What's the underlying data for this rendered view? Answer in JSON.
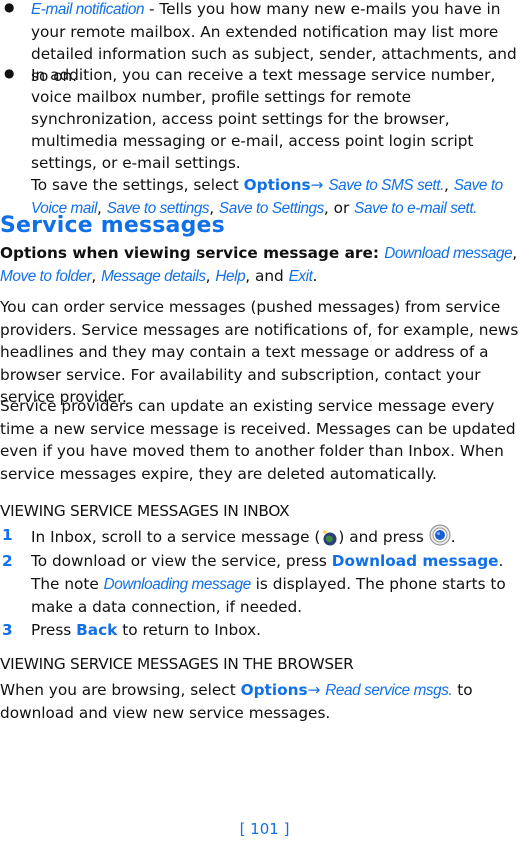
{
  "bullets": [
    {
      "term": "E-mail notification",
      "text": " - Tells you how many new e-mails you have in your remote mailbox. An extended notification may list more detailed information such as subject, sender, attachments, and so on."
    },
    {
      "text": "In addition, you can receive a text message service number, voice mailbox number, profile settings for remote synchronization, access point settings for the browser, multimedia messaging or e-mail, access point login script settings, or e-mail settings.",
      "save_prefix": "To save the settings, select ",
      "options_label": "Options",
      "arrow": "→ ",
      "save_options": [
        "Save to SMS sett.",
        "Save to Voice mail",
        "Save to settings",
        "Save to Settings",
        "Save to e-mail sett."
      ],
      "sep": ", ",
      "or": ", or "
    }
  ],
  "section": {
    "title": "Service messages",
    "options_intro": "Options when viewing service message are: ",
    "options": [
      "Download message",
      "Move to folder",
      "Message details",
      "Help",
      "Exit"
    ],
    "options_and": ", and ",
    "options_end": ".",
    "para1": "You can order service messages (pushed messages) from service providers. Service messages are notifications of, for example, news headlines and they may contain a text message or address of a browser service. For availability and subscription, contact your service provider.",
    "para2": "Service providers can update an existing service message every time a new service message is received. Messages can be updated even if you have moved them to another folder than Inbox. When service messages expire, they are deleted automatically."
  },
  "inbox": {
    "heading": "VIEWING SERVICE MESSAGES IN INBOX",
    "step1": {
      "num": "1",
      "a": "In Inbox, scroll to a service message (",
      "b": ") and press ",
      "c": "."
    },
    "step2": {
      "num": "2",
      "a": "To download or view the service, press ",
      "key": "Download message",
      "b": ". The note ",
      "note": "Downloading message",
      "c": " is displayed. The phone starts to make a data connection, if needed."
    },
    "step3": {
      "num": "3",
      "a": "Press ",
      "key": "Back",
      "b": " to return to Inbox."
    }
  },
  "browser": {
    "heading": "VIEWING SERVICE MESSAGES IN THE BROWSER",
    "a": "When you are browsing, select ",
    "options_label": "Options",
    "arrow": "→ ",
    "item": "Read service msgs.",
    "b": " to download and view new service messages."
  },
  "footer": {
    "page_number": "[ 101 ]"
  }
}
